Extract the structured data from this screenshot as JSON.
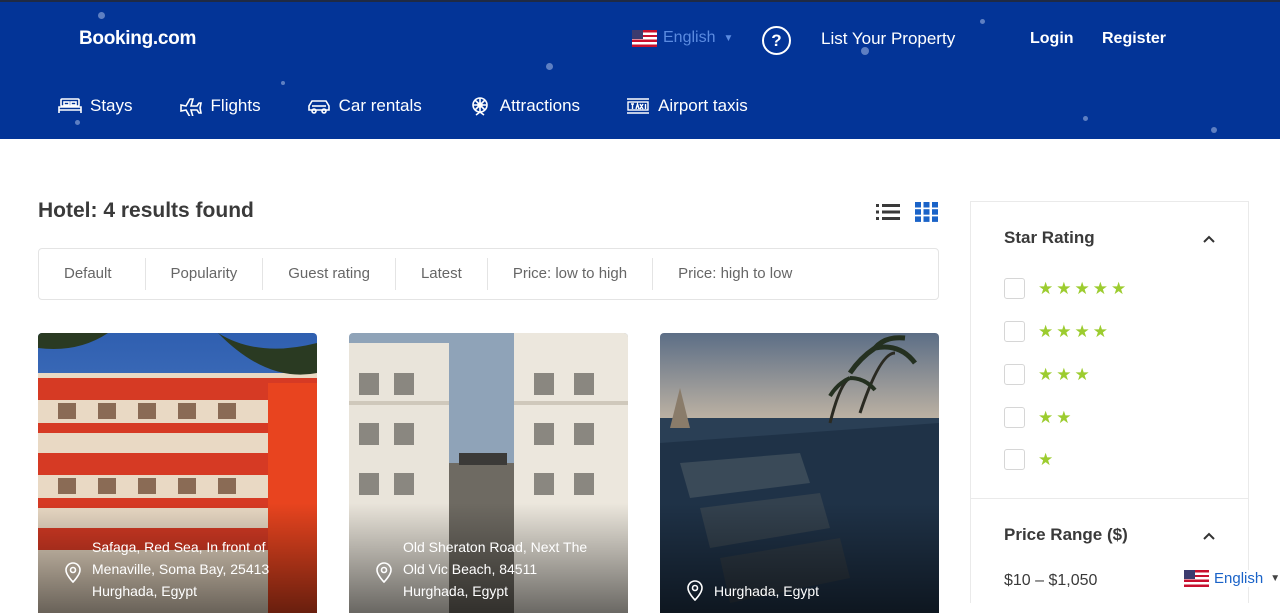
{
  "header": {
    "logo": "Booking.com",
    "language": "English",
    "list_property": "List Your Property",
    "login": "Login",
    "register": "Register"
  },
  "nav": [
    {
      "label": "Stays",
      "icon": "bed-icon"
    },
    {
      "label": "Flights",
      "icon": "plane-icon"
    },
    {
      "label": "Car rentals",
      "icon": "car-icon"
    },
    {
      "label": "Attractions",
      "icon": "attraction-icon"
    },
    {
      "label": "Airport taxis",
      "icon": "taxi-icon"
    }
  ],
  "results": {
    "title": "Hotel: 4 results found"
  },
  "sort": [
    "Default",
    "Popularity",
    "Guest rating",
    "Latest",
    "Price: low to high",
    "Price: high to low"
  ],
  "cards": [
    {
      "address": [
        "Safaga, Red Sea, In front of",
        "Menaville, Soma Bay, 25413",
        "Hurghada, Egypt"
      ]
    },
    {
      "address": [
        "Old Sheraton Road, Next The",
        "Old Vic Beach, 84511",
        "Hurghada, Egypt"
      ]
    },
    {
      "address": [
        "Hurghada, Egypt"
      ]
    }
  ],
  "sidebar": {
    "star_title": "Star Rating",
    "star_options": [
      5,
      4,
      3,
      2,
      1
    ],
    "price_title": "Price Range ($)",
    "price_value": "$10 – $1,050"
  },
  "language_widget": "English",
  "colors": {
    "header_bg": "#033497",
    "star": "#9ccc2f",
    "link": "#1a63c8"
  }
}
